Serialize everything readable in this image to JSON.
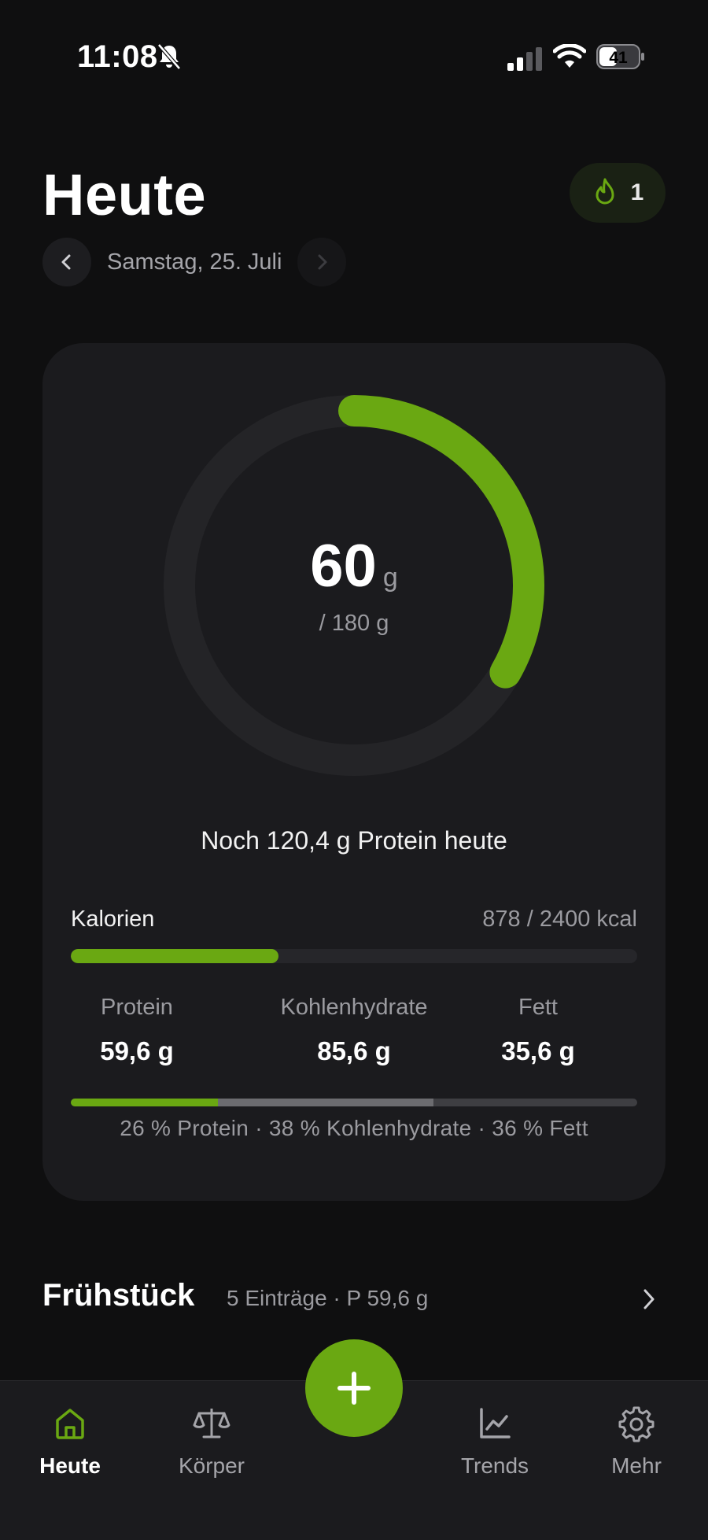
{
  "status_bar": {
    "time": "11:08",
    "battery_level": "41",
    "icons": [
      "bell-slash-icon",
      "signal-icon",
      "wifi-icon",
      "battery-icon"
    ]
  },
  "header": {
    "title": "Heute",
    "streak_count": "1",
    "streak_icon": "flame-icon",
    "date": "Samstag, 25. Juli"
  },
  "card": {
    "protein_value": "60",
    "protein_unit": "g",
    "protein_goal": "/ 180 g",
    "protein_progress": 0.333,
    "remaining_text": "Noch 120,4 g Protein heute",
    "calories": {
      "label": "Kalorien",
      "value_text": "878 / 2400 kcal",
      "progress": 0.366
    },
    "macros": [
      {
        "name": "Protein",
        "value": "59,6 g"
      },
      {
        "name": "Kohlenhydrate",
        "value": "85,6 g"
      },
      {
        "name": "Fett",
        "value": "35,6 g"
      }
    ],
    "macro_split": [
      26,
      38,
      36
    ],
    "macro_split_caption": "26 % Protein · 38 % Kohlenhydrate · 36 % Fett"
  },
  "meal": {
    "title": "Frühstück",
    "subtitle": "5 Einträge · P 59,6 g"
  },
  "tabbar": {
    "tabs": [
      {
        "label": "Heute",
        "icon": "home-icon"
      },
      {
        "label": "Körper",
        "icon": "scale-icon"
      },
      {
        "label": "Trends",
        "icon": "chart-icon"
      },
      {
        "label": "Mehr",
        "icon": "gear-icon"
      }
    ],
    "fab_icon": "plus-icon"
  },
  "colors": {
    "accent": "#6aa812",
    "background": "#0f0f10",
    "card": "#1b1b1e",
    "muted_text": "#9b9ba0"
  }
}
